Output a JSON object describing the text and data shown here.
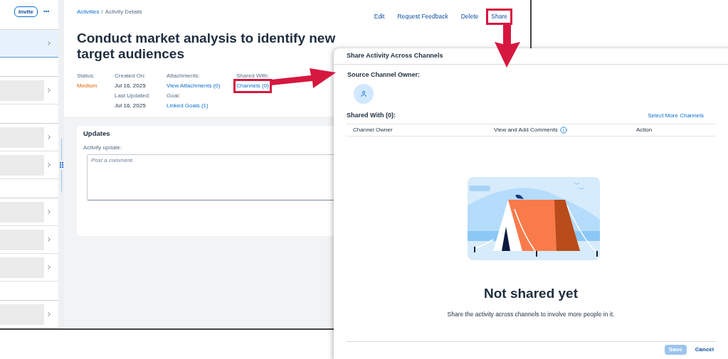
{
  "sidebar": {
    "invite": "Invite",
    "more": "•••",
    "groups": [
      {
        "rows": [
          {
            "selected": true
          }
        ]
      },
      {
        "rows": [
          {
            "selected": false
          }
        ]
      },
      {
        "rows": [
          {
            "selected": false
          },
          {
            "selected": false
          }
        ]
      },
      {
        "rows": [
          {
            "selected": false
          },
          {
            "selected": false
          },
          {
            "selected": false
          }
        ]
      },
      {
        "rows": [
          {
            "selected": false
          }
        ]
      }
    ]
  },
  "breadcrumb": {
    "link": "Activities",
    "separator": "/",
    "current": "Activity Details"
  },
  "actions": [
    {
      "label": "Edit",
      "highlighted": false
    },
    {
      "label": "Request Feedback",
      "highlighted": false
    },
    {
      "label": "Delete",
      "highlighted": false
    },
    {
      "label": "Share",
      "highlighted": true
    }
  ],
  "title": "Conduct market analysis to identify new target audiences",
  "field_columns": [
    [
      {
        "label": "Status:",
        "value": "Medium",
        "kind": "status",
        "highlighted": false
      }
    ],
    [
      {
        "label": "Created On:",
        "value": "Jul 16, 2025",
        "kind": "text",
        "highlighted": false
      },
      {
        "label": "Last Updated:",
        "value": "Jul 16, 2025",
        "kind": "text",
        "highlighted": false
      }
    ],
    [
      {
        "label": "Attachments:",
        "value": "View Attachments (0)",
        "kind": "link",
        "highlighted": false
      },
      {
        "label": "Goal:",
        "value": "Linked Goals (1)",
        "kind": "link",
        "highlighted": false
      }
    ],
    [
      {
        "label": "Shared With:",
        "value": "Channels (0)",
        "kind": "link",
        "highlighted": true
      }
    ]
  ],
  "updates": {
    "title": "Updates",
    "label": "Activity update:",
    "placeholder": "Post a comment."
  },
  "dialog": {
    "title": "Share Activity Across Channels",
    "source_label": "Source Channel Owner:",
    "shared_label": "Shared With (0):",
    "select_more": "Select More Channels",
    "columns": [
      {
        "label": "Channel Owner",
        "info": false
      },
      {
        "label": "View and Add Comments",
        "info": true
      },
      {
        "label": "Action",
        "info": false
      }
    ],
    "empty_title": "Not shared yet",
    "empty_text": "Share the activity across channels to involve more people in it.",
    "buttons": [
      {
        "label": "Save",
        "kind": "primary",
        "disabled": true
      },
      {
        "label": "Cancel",
        "kind": "ghost",
        "disabled": false
      }
    ]
  }
}
